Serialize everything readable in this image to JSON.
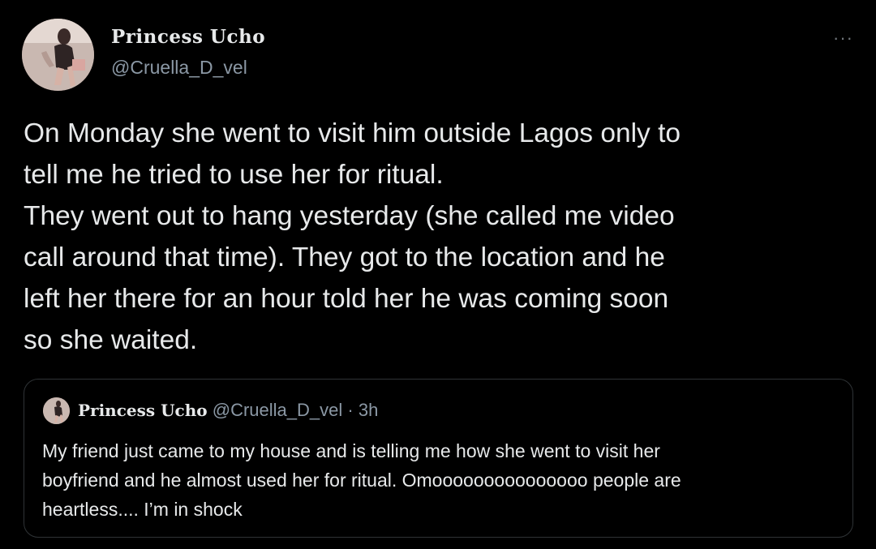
{
  "tweet": {
    "author": {
      "display_name": "Princess Ucho",
      "handle": "@Cruella_D_vel",
      "avatar_icon": "profile-photo"
    },
    "more_label": "···",
    "text": "On Monday she went to visit him outside Lagos only to\ntell me he tried to use her for ritual.\nThey went out to hang yesterday (she called me video\ncall around that time). They got to the location and he\nleft her there for an hour told her he was coming soon\nso she waited."
  },
  "quoted_tweet": {
    "author": {
      "display_name": "Princess Ucho",
      "handle": "@Cruella_D_vel",
      "avatar_icon": "profile-photo"
    },
    "separator": "·",
    "time": "3h",
    "text": "My friend just came to my house and is telling me how she went to visit her\nboyfriend and he almost used her for ritual. Omooooooooooooooo people are\nheartless.... I’m in shock"
  },
  "colors": {
    "background": "#000000",
    "primary_text": "#e7e9ea",
    "secondary_text": "#8b98a5",
    "border": "#2f3336"
  }
}
